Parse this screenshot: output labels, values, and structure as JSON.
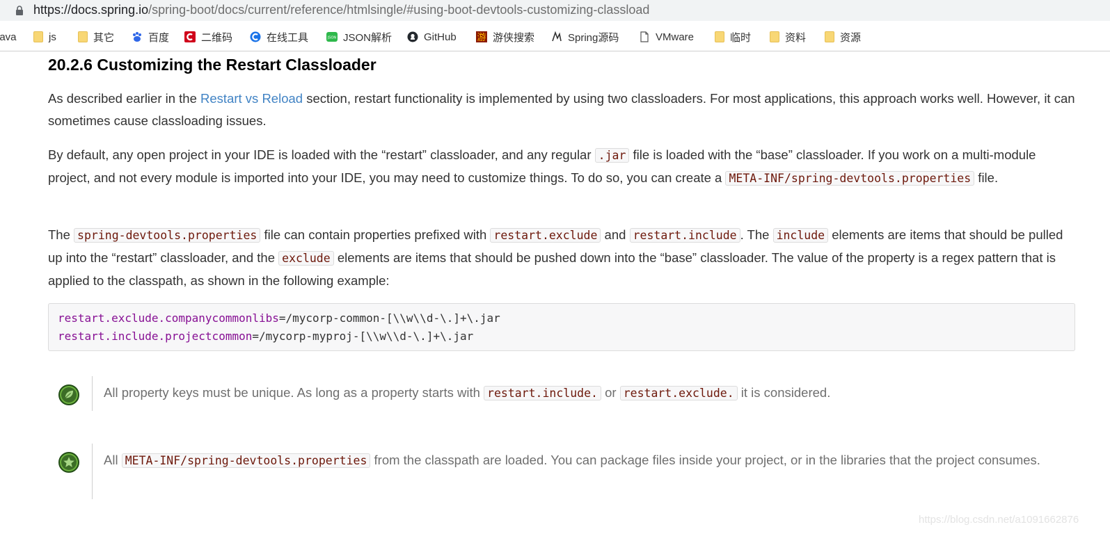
{
  "browser": {
    "url_host": "https://docs.spring.io",
    "url_path": "/spring-boot/docs/current/reference/htmlsingle/#using-boot-devtools-customizing-classload"
  },
  "bookmarks": [
    {
      "label": "java",
      "icon": "folder-icon"
    },
    {
      "label": "js",
      "icon": "folder-icon"
    },
    {
      "label": "其它",
      "icon": "folder-icon"
    },
    {
      "label": "百度",
      "icon": "baidu-icon"
    },
    {
      "label": "二维码",
      "icon": "qrcode-icon"
    },
    {
      "label": "在线工具",
      "icon": "tool-icon"
    },
    {
      "label": "JSON解析",
      "icon": "json-icon"
    },
    {
      "label": "GitHub",
      "icon": "github-icon"
    },
    {
      "label": "游侠搜索",
      "icon": "search-icon"
    },
    {
      "label": "Spring源码",
      "icon": "spring-icon"
    },
    {
      "label": "VMware",
      "icon": "page-icon"
    },
    {
      "label": "临时",
      "icon": "folder-icon"
    },
    {
      "label": "资料",
      "icon": "folder-icon"
    },
    {
      "label": "资源",
      "icon": "folder-icon"
    }
  ],
  "doc": {
    "heading": "20.2.6 Customizing the Restart Classloader",
    "p1": {
      "a": "As described earlier in the ",
      "link": "Restart vs Reload",
      "b": " section, restart functionality is implemented by using two classloaders. For most applications, this approach works well. However, it can sometimes cause classloading issues."
    },
    "p2": {
      "a": "By default, any open project in your IDE is loaded with the “restart” classloader, and any regular ",
      "code1": ".jar",
      "b": " file is loaded with the “base” classloader. If you work on a multi-module project, and not every module is imported into your IDE, you may need to customize things. To do so, you can create a ",
      "code2": "META-INF/spring-devtools.properties",
      "c": " file."
    },
    "p3": {
      "a": "The ",
      "code1": "spring-devtools.properties",
      "b": " file can contain properties prefixed with ",
      "code2": "restart.exclude",
      "c": " and ",
      "code3": "restart.include",
      "d": ". The ",
      "code4": "include",
      "e": " elements are items that should be pulled up into the “restart” classloader, and the ",
      "code5": "exclude",
      "f": " elements are items that should be pushed down into the “base” classloader. The value of the property is a regex pattern that is applied to the classpath, as shown in the following example:"
    },
    "code": [
      {
        "key": "restart.exclude.companycommonlibs",
        "value": "=/mycorp-common-[\\\\w\\\\d-\\.]+\\.jar"
      },
      {
        "key": "restart.include.projectcommon",
        "value": "=/mycorp-myproj-[\\\\w\\\\d-\\.]+\\.jar"
      }
    ],
    "tip": {
      "a": "All property keys must be unique. As long as a property starts with ",
      "code1": "restart.include.",
      "b": " or ",
      "code2": "restart.exclude.",
      "c": " it is considered."
    },
    "note": {
      "a": "All ",
      "code1": "META-INF/spring-devtools.properties",
      "b": " from the classpath are loaded. You can package files inside your project, or in the libraries that the project consumes."
    }
  },
  "watermark": "https://blog.csdn.net/a1091662876",
  "colors": {
    "link": "#4183c4",
    "code": "#6d180b",
    "key": "#871094",
    "badge": "#3b6d26"
  }
}
